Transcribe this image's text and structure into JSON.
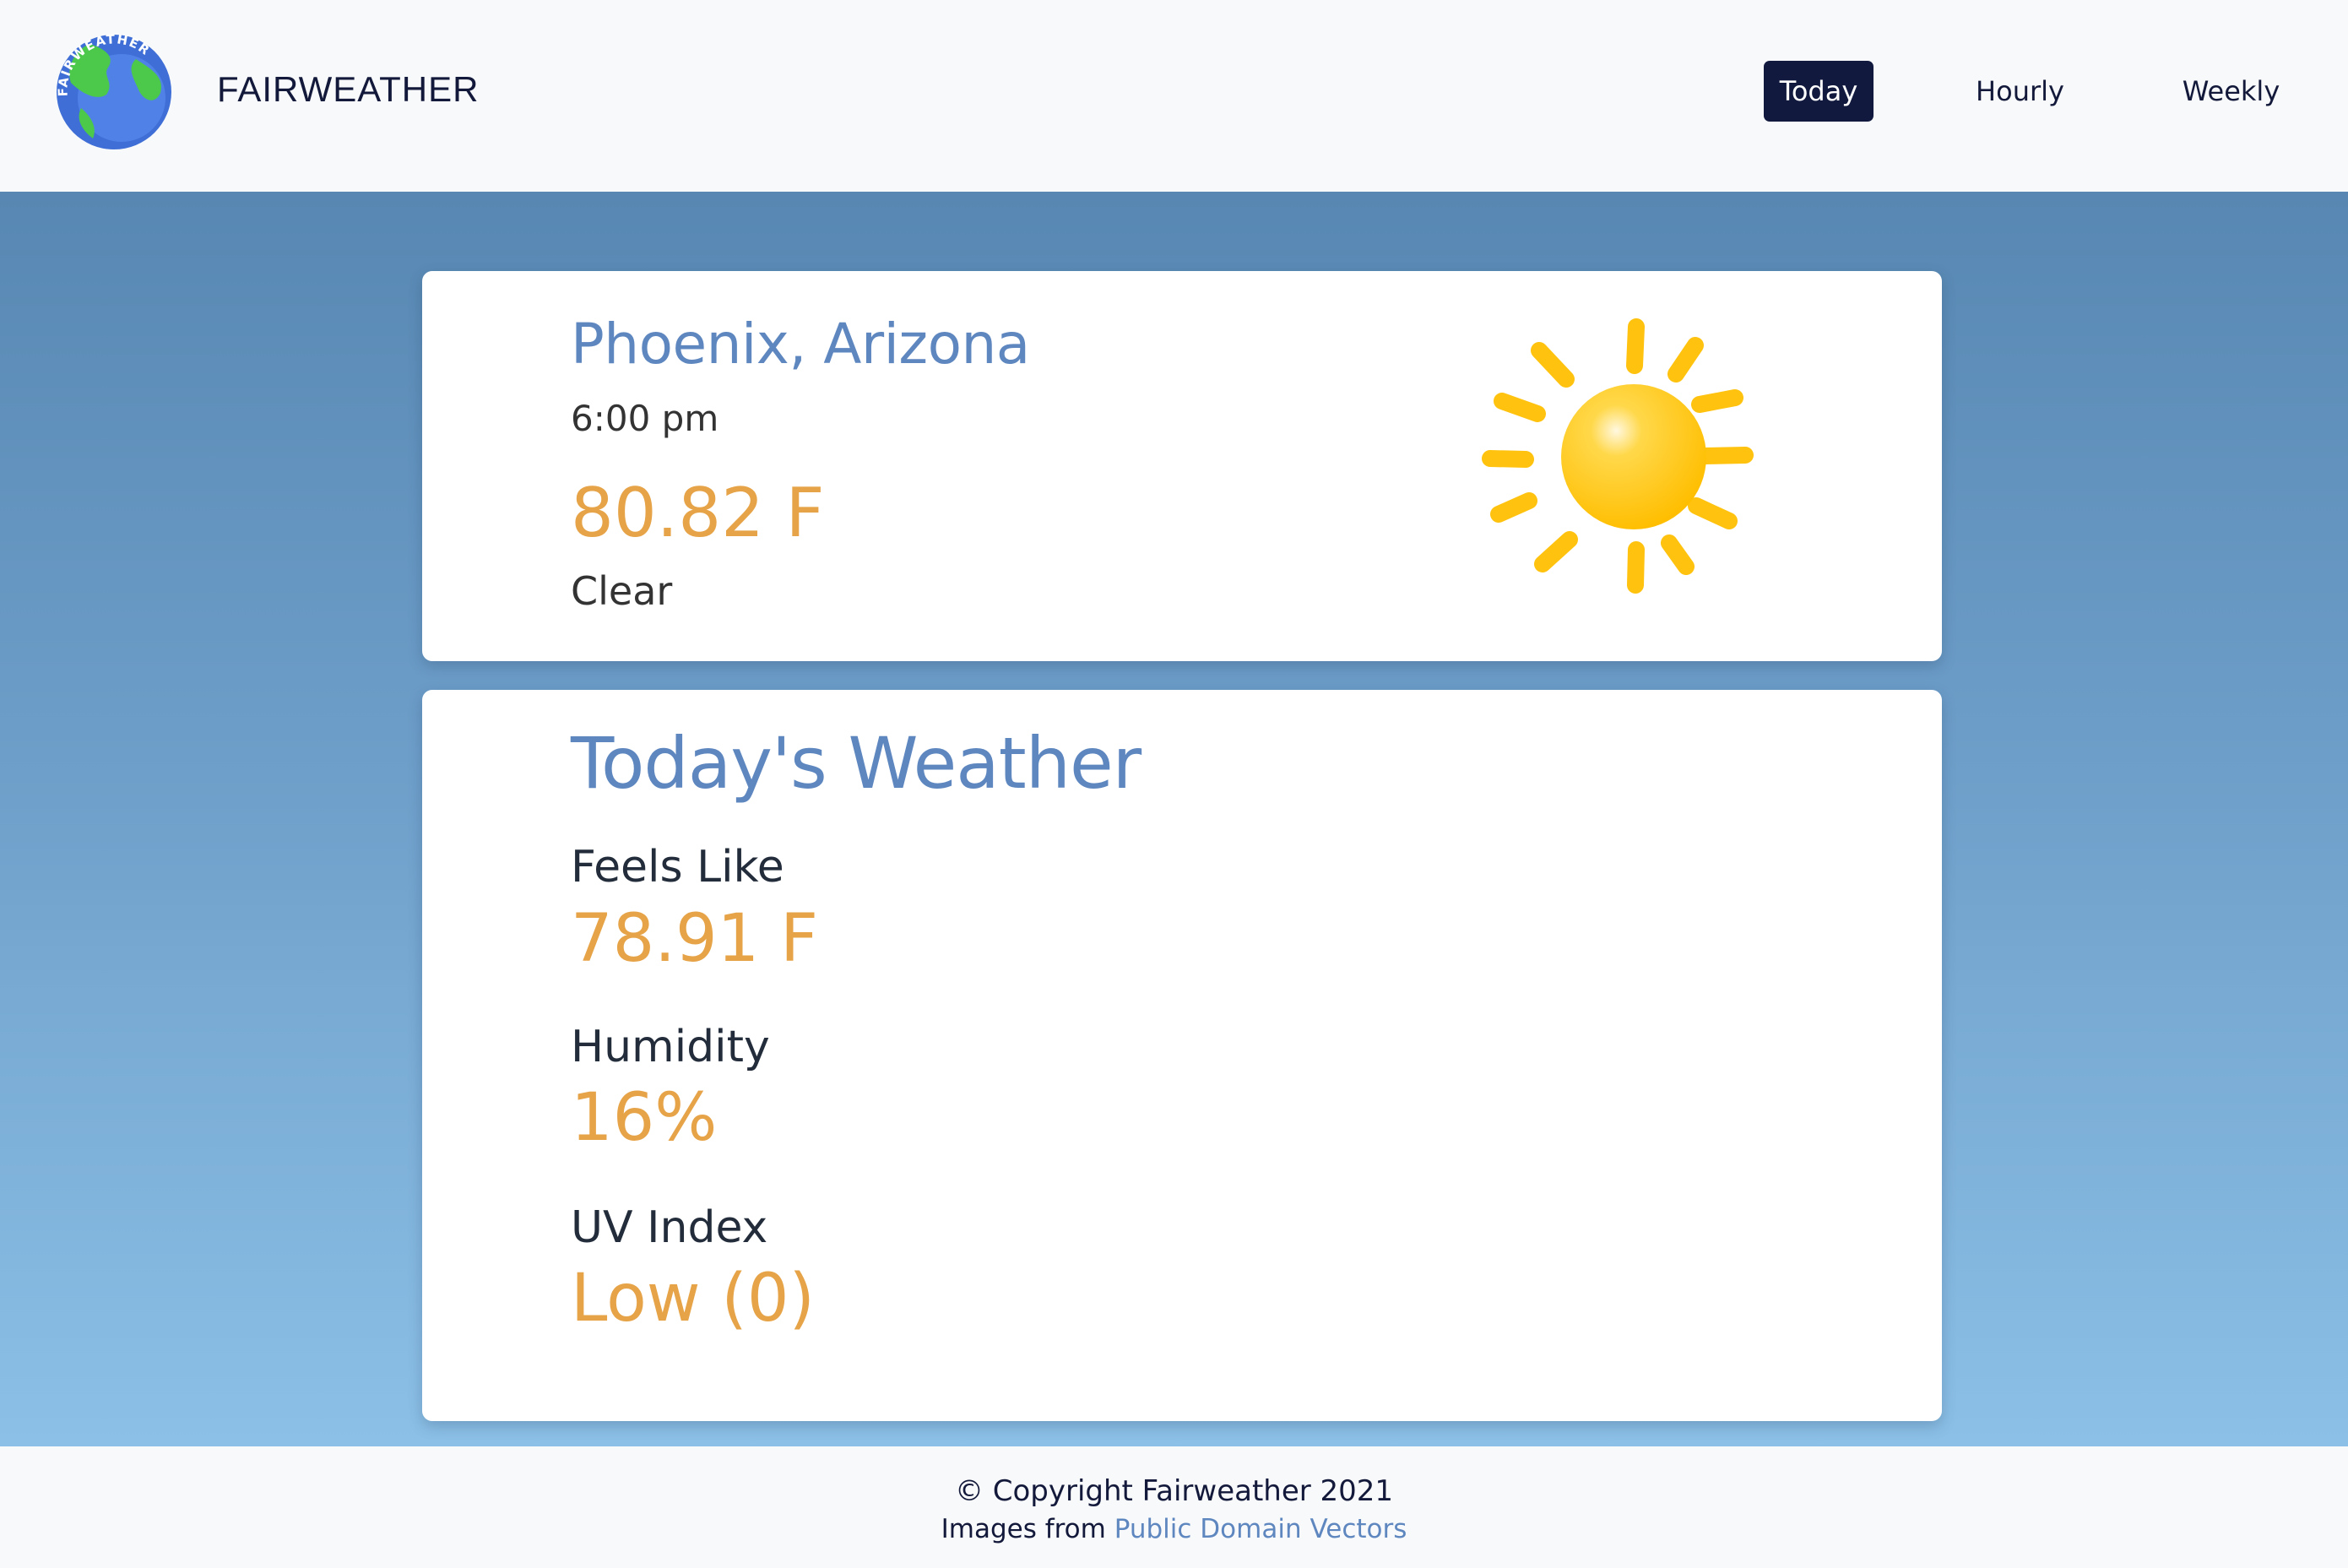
{
  "header": {
    "brand": "FAIRWEATHER",
    "logo_text": "FAIRWEATHER",
    "nav": {
      "today": "Today",
      "hourly": "Hourly",
      "weekly": "Weekly"
    },
    "active_tab": "Today"
  },
  "current": {
    "city": "Phoenix, Arizona",
    "time": "6:00 pm",
    "temperature": "80.82 F",
    "condition": "Clear",
    "icon": "sun-icon"
  },
  "today": {
    "title": "Today's Weather",
    "feels_like_label": "Feels Like",
    "feels_like_value": "78.91 F",
    "humidity_label": "Humidity",
    "humidity_value": "16%",
    "uv_label": "UV Index",
    "uv_value": "Low (0)"
  },
  "footer": {
    "copyright": "© Copyright Fairweather 2021",
    "credits_prefix": "Images from",
    "credits_link": "Public Domain Vectors"
  },
  "colors": {
    "accent_blue": "#5e87c0",
    "accent_orange": "#e6a347",
    "nav_dark": "#111a3e",
    "sun_yellow": "#ffc20e"
  }
}
